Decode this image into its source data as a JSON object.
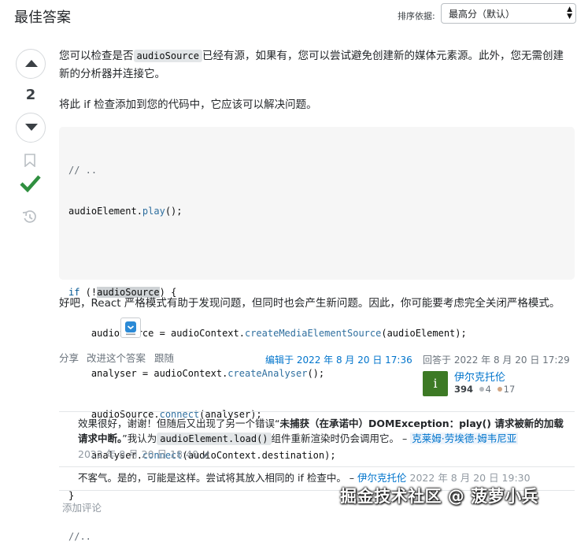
{
  "header": {
    "title": "最佳答案",
    "sort_label": "排序依据:",
    "sort_value": "最高分（默认）"
  },
  "vote": {
    "score": "2",
    "accepted": true
  },
  "answer": {
    "p1_before": "您可以检查是否",
    "p1_code": "audioSource",
    "p1_after": "已经有源，如果有，您可以尝试避免创建新的媒体元素源。此外，您无需创建新的分析器并连接它。",
    "p2": "将此 if 检查添加到您的代码中，它应该可以解决问题。",
    "code_lines": [
      "// ..",
      "audioElement.play();",
      "",
      "if (!audioSource) {",
      "    audioSource = audioContext.createMediaElementSource(audioElement);",
      "    analyser = audioContext.createAnalyser();",
      "    audioSource.connect(analyser);",
      "    analyser.connect(audioContext.destination);",
      "}",
      "//.."
    ],
    "p3": "好吧，React 严格模式有助于发现问题，但同时也会产生新问题。因此，你可能要考虑完全关闭严格模式。"
  },
  "post_menu": {
    "share": "分享",
    "improve": "改进这个答案",
    "follow": "跟随"
  },
  "edited": "编辑于 2022 年 8 月 20 日 17:36",
  "answered": "回答于 2022 年 8 月 20 日 17:29",
  "author": {
    "name": "伊尔克托伦",
    "avatar_letter": "i",
    "reputation": "394",
    "silver": "4",
    "bronze": "17",
    "colors": {
      "avatar": "#3d7a25",
      "silver": "#b4b8bc",
      "bronze": "#d1a684"
    }
  },
  "comments": [
    {
      "text_a": "效果很好，谢谢！但随后又出现了另一个错误“",
      "text_bold": "未捕获（在承诺中）DOMException：play() 请求被新的加载",
      "text_bold2": "请求中断。",
      "text_b": "”我认为",
      "code": "audioElement.load()",
      "text_c": "组件重新渲染时仍会调用它。 –",
      "user": "克莱姆·劳埃德·姆韦尼亚",
      "time": "2022 年 8 月 20 日 18:40"
    },
    {
      "text": "不客气。是的，可能是这样。尝试将其放入相同的 if 检查中。 –",
      "user": "伊尔克托伦",
      "time": "2022 年 8 月 20 日 19:30"
    }
  ],
  "add_comment": "添加评论",
  "watermark": "掘金技术社区 @ 菠萝小兵"
}
